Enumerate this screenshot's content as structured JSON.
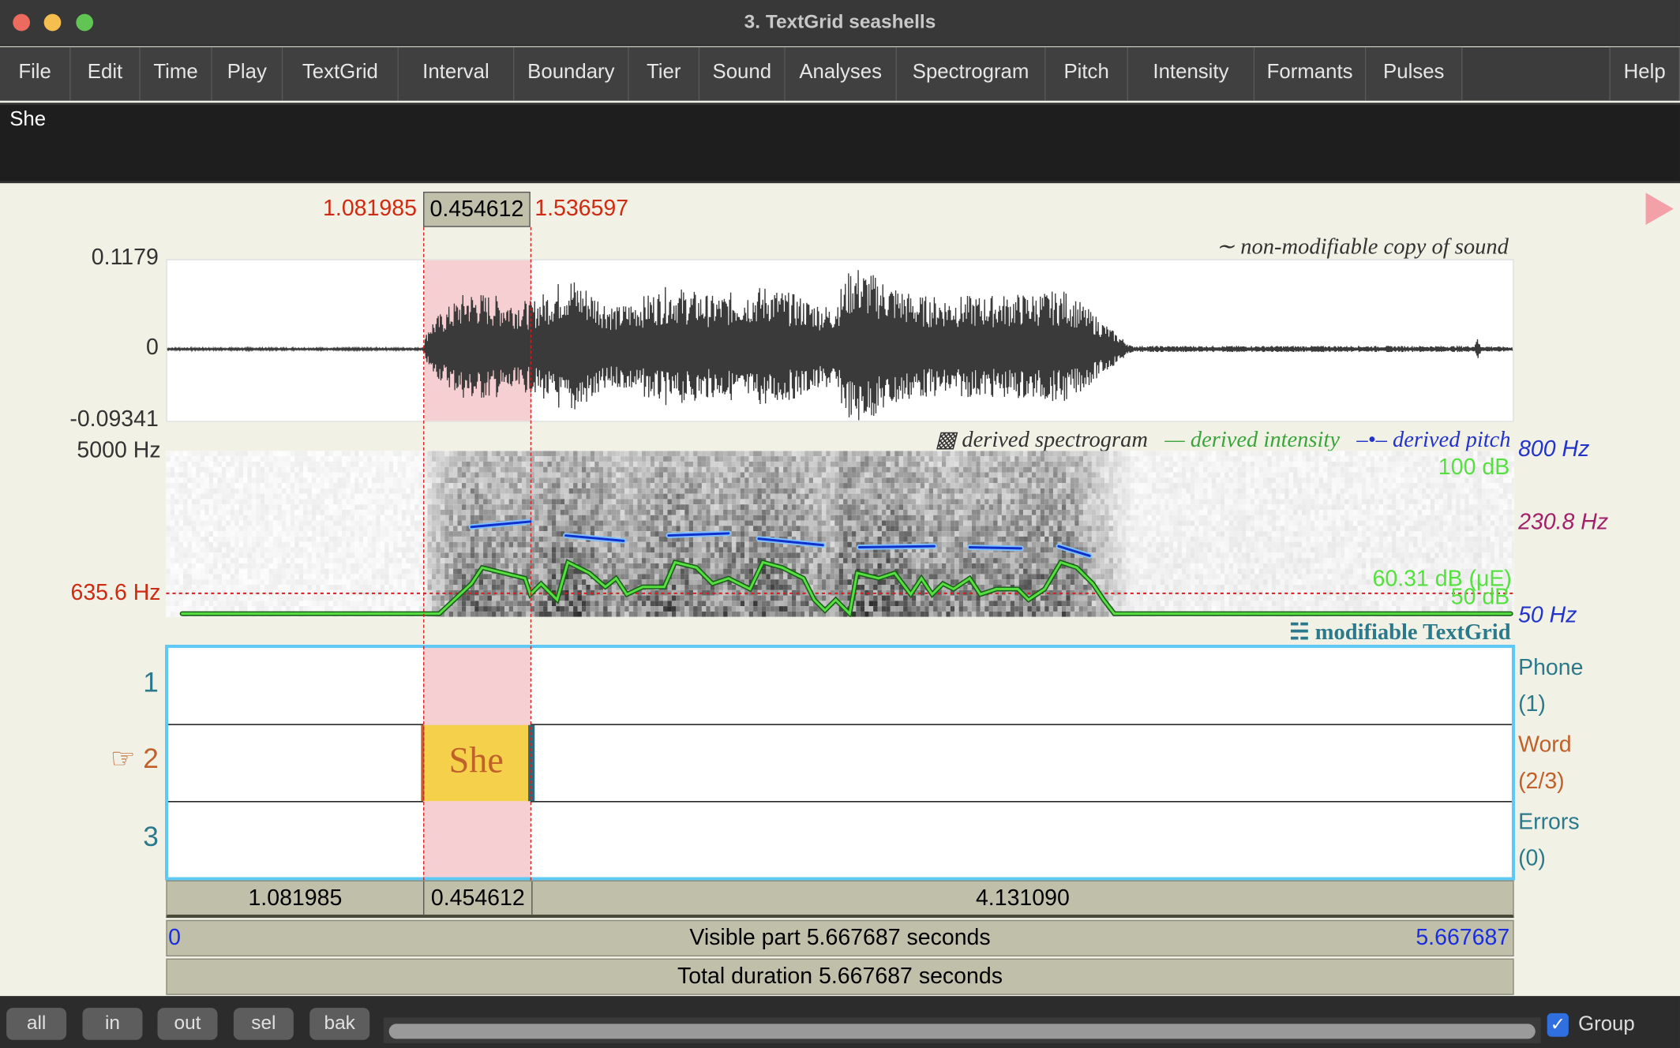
{
  "window": {
    "title": "3. TextGrid seashells"
  },
  "menu": [
    "File",
    "Edit",
    "Time",
    "Play",
    "TextGrid",
    "Interval",
    "Boundary",
    "Tier",
    "Sound",
    "Analyses",
    "Spectrogram",
    "Pitch",
    "Intensity",
    "Formants",
    "Pulses"
  ],
  "help": "Help",
  "text_field": "She",
  "selection": {
    "start": "1.081985",
    "length": "0.454612",
    "end": "1.536597",
    "color": "#f6cfd2"
  },
  "sound": {
    "title": "non-modifiable copy of sound",
    "ymax": "0.1179",
    "yzero": "0",
    "ymin": "-0.09341"
  },
  "spectrogram": {
    "legend_spectrogram": "derived spectrogram",
    "legend_intensity": "derived intensity",
    "legend_pitch": "derived pitch",
    "fmax": "5000 Hz",
    "cursor_freq": "635.6 Hz",
    "pitch_max": "800 Hz",
    "pitch_cursor": "230.8 Hz",
    "pitch_min": "50 Hz",
    "int_max": "100 dB",
    "int_cursor": "60.31 dB (μE)",
    "int_min": "50 dB"
  },
  "textgrid": {
    "title": "modifiable TextGrid",
    "pointer": "☞",
    "tiers": [
      {
        "num": "1",
        "name": "Phone",
        "count": "(1)"
      },
      {
        "num": "2",
        "name": "Word",
        "count": "(2/3)"
      },
      {
        "num": "3",
        "name": "Errors",
        "count": "(0)"
      }
    ],
    "interval_text": "She",
    "interval_color": "#f5d04a"
  },
  "durations": {
    "left": "1.081985",
    "sel": "0.454612",
    "right": "4.131090"
  },
  "visible": {
    "start": "0",
    "label": "Visible part 5.667687 seconds",
    "end": "5.667687"
  },
  "total": "Total duration 5.667687 seconds",
  "bottom": {
    "buttons": [
      "all",
      "in",
      "out",
      "sel",
      "bak"
    ],
    "group_label": "Group",
    "group_checked": true
  }
}
